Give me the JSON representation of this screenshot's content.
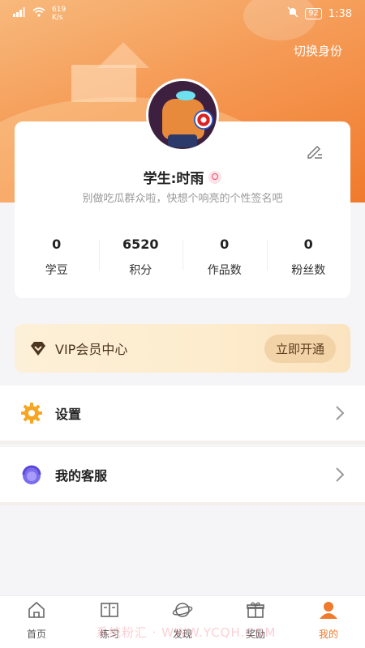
{
  "status_bar": {
    "speed_value": "619",
    "speed_unit": "K/s",
    "battery": "92",
    "time": "1:38"
  },
  "header": {
    "switch_identity": "切换身份"
  },
  "profile": {
    "name": "学生:时雨",
    "signature": "别做吃瓜群众啦，快想个响亮的个性签名吧",
    "stats": [
      {
        "value": "0",
        "label": "学豆"
      },
      {
        "value": "6520",
        "label": "积分"
      },
      {
        "value": "0",
        "label": "作品数"
      },
      {
        "value": "0",
        "label": "粉丝数"
      }
    ]
  },
  "vip": {
    "title": "VIP会员中心",
    "button": "立即开通"
  },
  "menu": [
    {
      "label": "设置",
      "icon": "gear-icon"
    },
    {
      "label": "我的客服",
      "icon": "headset-icon"
    }
  ],
  "bottom_nav": [
    {
      "label": "首页",
      "icon": "home-icon"
    },
    {
      "label": "练习",
      "icon": "book-icon"
    },
    {
      "label": "发现",
      "icon": "planet-icon"
    },
    {
      "label": "奖励",
      "icon": "gift-icon"
    },
    {
      "label": "我的",
      "icon": "user-icon",
      "active": true
    }
  ],
  "watermark": "系统粉汇 · WWW.YCQH.COM",
  "colors": {
    "accent": "#f07a2c",
    "vip_bg": "#fdf0d8",
    "vip_button": "#f2d3a8"
  }
}
